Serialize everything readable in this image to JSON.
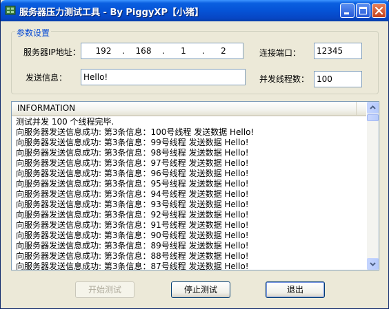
{
  "window": {
    "title": "服务器压力测试工具 - By PiggyXP【小猪】"
  },
  "params": {
    "group_title": "参数设置",
    "server_ip_label": "服务器IP地址：",
    "ip": [
      "192",
      "168",
      "1",
      "2"
    ],
    "ip_dot": ".",
    "port_label": "连接端口：",
    "port_value": "12345",
    "message_label": "发送信息：",
    "message_value": "Hello!",
    "threads_label": "并发线程数：",
    "threads_value": "100"
  },
  "log": {
    "header": "INFORMATION",
    "rows": [
      "测试并发 100 个线程完毕.",
      "向服务器发送信息成功: 第3条信息：100号线程 发送数据 Hello!",
      "向服务器发送信息成功: 第3条信息：99号线程 发送数据 Hello!",
      "向服务器发送信息成功: 第3条信息：98号线程 发送数据 Hello!",
      "向服务器发送信息成功: 第3条信息：97号线程 发送数据 Hello!",
      "向服务器发送信息成功: 第3条信息：96号线程 发送数据 Hello!",
      "向服务器发送信息成功: 第3条信息：95号线程 发送数据 Hello!",
      "向服务器发送信息成功: 第3条信息：94号线程 发送数据 Hello!",
      "向服务器发送信息成功: 第3条信息：93号线程 发送数据 Hello!",
      "向服务器发送信息成功: 第3条信息：92号线程 发送数据 Hello!",
      "向服务器发送信息成功: 第3条信息：91号线程 发送数据 Hello!",
      "向服务器发送信息成功: 第3条信息：90号线程 发送数据 Hello!",
      "向服务器发送信息成功: 第3条信息：89号线程 发送数据 Hello!",
      "向服务器发送信息成功: 第3条信息：88号线程 发送数据 Hello!",
      "向服务器发送信息成功: 第3条信息：87号线程 发送数据 Hello!"
    ]
  },
  "buttons": {
    "start": "开始测试",
    "stop": "停止测试",
    "exit": "退出"
  }
}
